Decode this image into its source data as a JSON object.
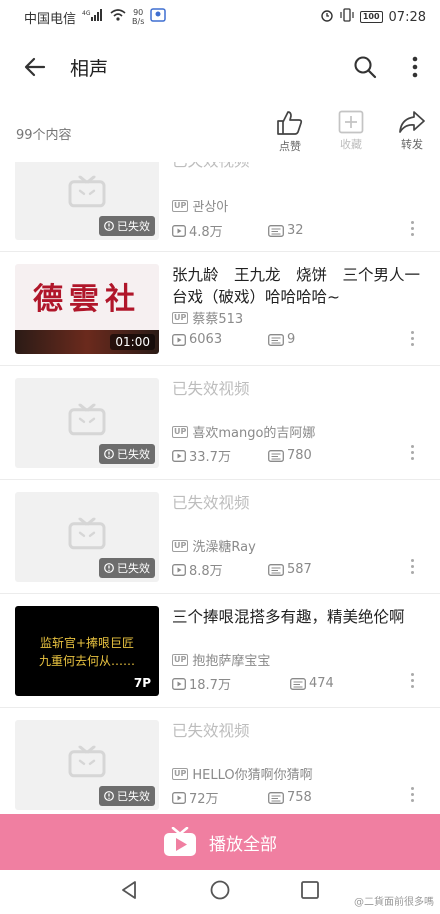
{
  "status_bar": {
    "carrier": "中国电信",
    "speed_value": "90",
    "speed_unit": "B/s",
    "battery": "100",
    "time": "07:28"
  },
  "header": {
    "title": "相声"
  },
  "info": {
    "content_count": "99个内容",
    "actions": [
      {
        "label": "点赞",
        "icon": "thumbs-up-icon"
      },
      {
        "label": "收藏",
        "icon": "add-favorite-icon"
      },
      {
        "label": "转发",
        "icon": "share-icon"
      }
    ]
  },
  "list": {
    "items": [
      {
        "title": "已失效视频",
        "invalid": true,
        "badge": "已失效",
        "uploader": "관상아",
        "views": "4.8万",
        "danmaku": "32"
      },
      {
        "title": "张九龄　王九龙　烧饼　三个男人一台戏（破戏）哈哈哈哈~",
        "invalid": false,
        "thumb_text": "德雲社",
        "badge": "01:00",
        "uploader": "蔡蔡513",
        "views": "6063",
        "danmaku": "9"
      },
      {
        "title": "已失效视频",
        "invalid": true,
        "badge": "已失效",
        "uploader": "喜欢mango的吉阿娜",
        "views": "33.7万",
        "danmaku": "780"
      },
      {
        "title": "已失效视频",
        "invalid": true,
        "badge": "已失效",
        "uploader": "洗澡糖Ray",
        "views": "8.8万",
        "danmaku": "587"
      },
      {
        "title": "三个捧哏混搭多有趣，精美绝伦啊",
        "invalid": false,
        "thumb_line1": "监斩官+捧哏巨匠",
        "thumb_line2": "九重何去何从……",
        "badge": "7P",
        "uploader": "抱抱萨摩宝宝",
        "views": "18.7万",
        "danmaku": "474"
      },
      {
        "title": "已失效视频",
        "invalid": true,
        "badge": "已失效",
        "uploader": "HELLO你猜啊你猜啊",
        "views": "72万",
        "danmaku": "758"
      }
    ]
  },
  "play_all": {
    "label": "播放全部"
  },
  "watermark": "@二貨面前很多嗎",
  "colors": {
    "accent": "#f07fa1",
    "text": "#212121",
    "muted": "#8a8a8a",
    "invalid": "#bdbdbd"
  }
}
